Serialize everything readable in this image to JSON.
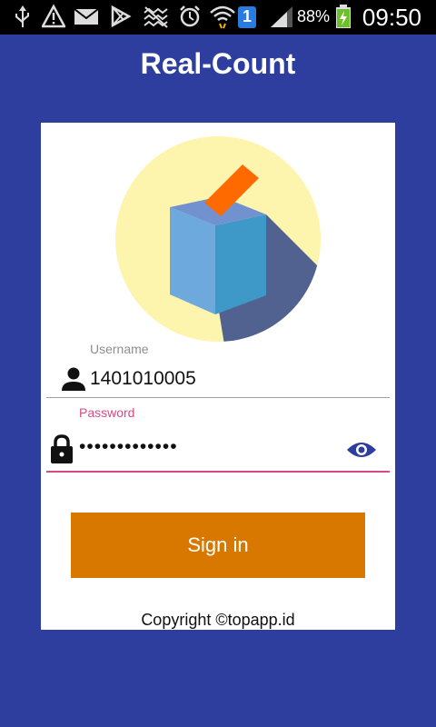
{
  "status_bar": {
    "battery_percent": "88%",
    "time": "09:50",
    "sim_badge": "1",
    "icons": [
      "usb-icon",
      "warning-icon",
      "mail-icon",
      "play-store-icon",
      "no-signal-icon",
      "alarm-icon",
      "wifi-icon",
      "sim-icon",
      "signal-icon",
      "battery-icon"
    ]
  },
  "app": {
    "title": "Real-Count"
  },
  "logo": {
    "icon": "ballot-box-icon",
    "colors": {
      "circle": "#fdf5ad",
      "shadow": "#526290",
      "box_front": "#6ea9de",
      "box_side": "#3e99c8",
      "box_top": "#7192cf",
      "ballot": "#ff6a00"
    }
  },
  "form": {
    "username": {
      "label": "Username",
      "value": "1401010005",
      "icon": "person-icon"
    },
    "password": {
      "label": "Password",
      "value": "•••••••••••••",
      "icon": "lock-icon",
      "toggle_icon": "eye-icon"
    }
  },
  "sign_in": {
    "label": "Sign in"
  },
  "footer": {
    "copyright": "Copyright ©topapp.id"
  },
  "colors": {
    "background": "#2d3e9e",
    "accent": "#d64a85",
    "button": "#d97800"
  }
}
